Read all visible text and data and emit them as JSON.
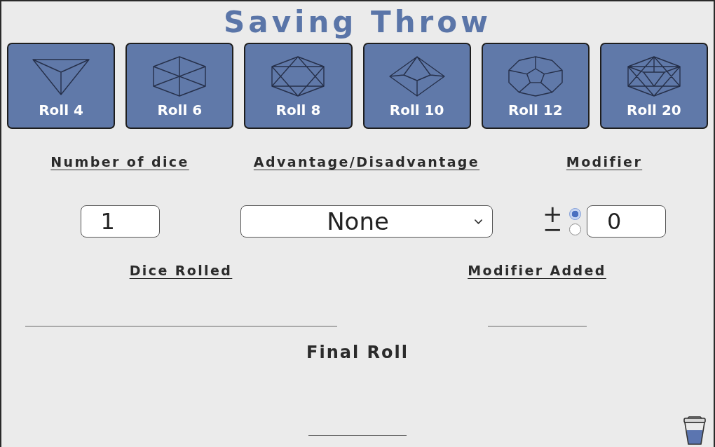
{
  "title": "Saving Throw",
  "dice_buttons": [
    {
      "kind": "d4",
      "label": "Roll 4"
    },
    {
      "kind": "d6",
      "label": "Roll 6"
    },
    {
      "kind": "d8",
      "label": "Roll 8"
    },
    {
      "kind": "d10",
      "label": "Roll 10"
    },
    {
      "kind": "d12",
      "label": "Roll 12"
    },
    {
      "kind": "d20",
      "label": "Roll 20"
    }
  ],
  "settings": {
    "number_of_dice": {
      "label": "Number of dice",
      "value": "1"
    },
    "advantage": {
      "label": "Advantage/Disadvantage",
      "value": "None"
    },
    "modifier": {
      "label": "Modifier",
      "signs": [
        {
          "symbol": "+",
          "selected": true
        },
        {
          "symbol": "−",
          "selected": false
        }
      ],
      "value": "0"
    }
  },
  "results": [
    {
      "label": "Dice Rolled"
    },
    {
      "label": "Modifier Added"
    }
  ],
  "final_roll": {
    "label": "Final Roll"
  }
}
